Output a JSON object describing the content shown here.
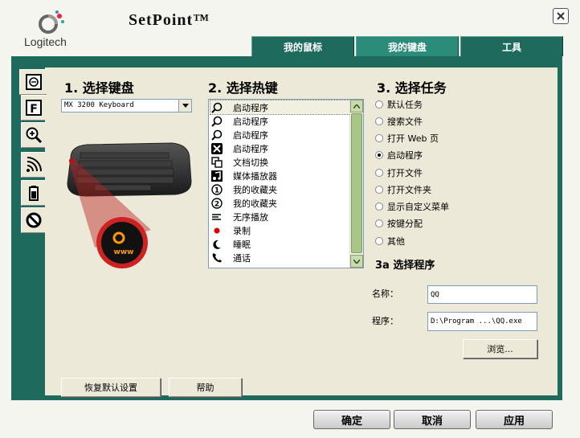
{
  "header": {
    "brand": "Logitech",
    "title": "SetPoint™"
  },
  "tabs": [
    {
      "label": "我的鼠标",
      "active": false
    },
    {
      "label": "我的键盘",
      "active": true
    },
    {
      "label": "工具",
      "active": false
    }
  ],
  "sidebar_icons": [
    "keyboard-icon",
    "f-key-icon",
    "zoom-icon",
    "wireless-icon",
    "battery-icon",
    "disable-icon"
  ],
  "section1": {
    "title": "1. 选择键盘",
    "keyboard_value": "MX 3200 Keyboard",
    "zoom_key_label": "www"
  },
  "section2": {
    "title": "2. 选择热键",
    "hotkeys": [
      {
        "label": "启动程序",
        "icon": "magnifier-icon",
        "selected": true
      },
      {
        "label": "启动程序",
        "icon": "magnifier-icon",
        "selected": false
      },
      {
        "label": "启动程序",
        "icon": "magnifier-icon",
        "selected": false
      },
      {
        "label": "启动程序",
        "icon": "x-box-icon",
        "selected": false
      },
      {
        "label": "文档切换",
        "icon": "document-switch-icon",
        "selected": false
      },
      {
        "label": "媒体播放器",
        "icon": "music-note-icon",
        "selected": false
      },
      {
        "label": "我的收藏夹",
        "icon": "circle-1-icon",
        "selected": false
      },
      {
        "label": "我的收藏夹",
        "icon": "circle-2-icon",
        "selected": false
      },
      {
        "label": "无序播放",
        "icon": "shuffle-icon",
        "selected": false
      },
      {
        "label": "录制",
        "icon": "record-dot-icon",
        "selected": false
      },
      {
        "label": "睡眠",
        "icon": "moon-icon",
        "selected": false
      },
      {
        "label": "通话",
        "icon": "phone-icon",
        "selected": false
      }
    ]
  },
  "section3": {
    "title": "3. 选择任务",
    "tasks": [
      {
        "label": "默认任务",
        "checked": false
      },
      {
        "label": "搜索文件",
        "checked": false
      },
      {
        "label": "打开 Web 页",
        "checked": false
      },
      {
        "label": "启动程序",
        "checked": true
      },
      {
        "label": "打开文件",
        "checked": false
      },
      {
        "label": "打开文件夹",
        "checked": false
      },
      {
        "label": "显示自定义菜单",
        "checked": false
      },
      {
        "label": "按键分配",
        "checked": false
      },
      {
        "label": "其他",
        "checked": false
      }
    ],
    "sub_title": "3a 选择程序",
    "name_label": "名称：",
    "name_value": "QQ",
    "program_label": "程序：",
    "program_value": "D:\\Program ...\\QQ.exe",
    "browse_label": "浏览..."
  },
  "bottom": {
    "restore_label": "恢复默认设置",
    "help_label": "帮助"
  },
  "dialog": {
    "ok_label": "确定",
    "cancel_label": "取消",
    "apply_label": "应用"
  },
  "colors": {
    "frame_green": "#1e6b5d",
    "tab_active": "#2c8c7a",
    "panel_bg": "#ece9d8",
    "scroll_green": "#a8c68a"
  }
}
